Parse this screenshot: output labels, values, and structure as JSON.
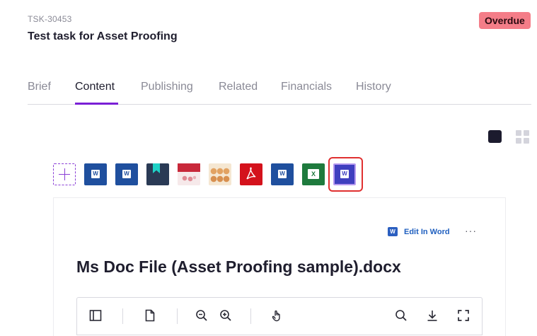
{
  "task": {
    "id": "TSK-30453",
    "title": "Test task for Asset Proofing",
    "status": "Overdue",
    "status_color": "#f47d88"
  },
  "tabs": [
    {
      "label": "Brief"
    },
    {
      "label": "Content"
    },
    {
      "label": "Publishing"
    },
    {
      "label": "Related"
    },
    {
      "label": "Financials"
    },
    {
      "label": "History"
    }
  ],
  "active_tab": "Content",
  "accent_color": "#7a1fd6",
  "view_toggle": [
    "single-view-icon",
    "grid-view-icon"
  ],
  "assets": [
    {
      "type": "word",
      "icon": "word-file-icon"
    },
    {
      "type": "word",
      "icon": "word-file-icon"
    },
    {
      "type": "bookmark",
      "icon": "bookmark-file-icon"
    },
    {
      "type": "document-thumbnail",
      "icon": "document-thumbnail"
    },
    {
      "type": "image-thumbnail",
      "icon": "image-thumbnail"
    },
    {
      "type": "pdf",
      "icon": "pdf-file-icon"
    },
    {
      "type": "word",
      "icon": "word-file-icon"
    },
    {
      "type": "excel",
      "icon": "excel-file-icon"
    },
    {
      "type": "word",
      "icon": "word-file-icon",
      "selected": true
    }
  ],
  "preview": {
    "edit_label": "Edit In Word",
    "more_label": "···",
    "file_title": "Ms Doc File (Asset Proofing sample).docx",
    "word_badge": "W",
    "excel_badge": "X"
  },
  "toolbar": [
    "sidebar-toggle-icon",
    "page-icon",
    "zoom-out-icon",
    "zoom-in-icon",
    "pan-hand-icon",
    "search-icon",
    "download-icon",
    "fullscreen-icon"
  ]
}
